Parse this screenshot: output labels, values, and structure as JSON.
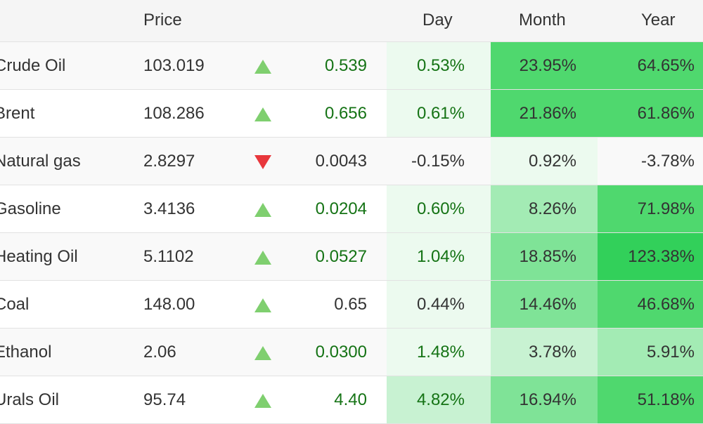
{
  "header": {
    "price": "Price",
    "day": "Day",
    "month": "Month",
    "year": "Year"
  },
  "colors": {
    "up_text": "#157315",
    "down_text": "#a00000",
    "up_arrow": "#7fcf6f",
    "down_arrow": "#e8373c",
    "heat_1": "#ecfaef",
    "heat_2": "#c8f2d2",
    "heat_3": "#a3ebb4",
    "heat_4": "#7fe397",
    "heat_5": "#4fd86e",
    "heat_6": "#32d05a"
  },
  "rows": [
    {
      "name": "Crude Oil",
      "price": "103.019",
      "direction": "up",
      "arrow_icon": "triangle-up-icon",
      "change": "0.539",
      "day": "0.53%",
      "month": "23.95%",
      "year": "64.65%"
    },
    {
      "name": "Brent",
      "price": "108.286",
      "direction": "up",
      "arrow_icon": "triangle-up-icon",
      "change": "0.656",
      "day": "0.61%",
      "month": "21.86%",
      "year": "61.86%"
    },
    {
      "name": "Natural gas",
      "price": "2.8297",
      "direction": "down",
      "arrow_icon": "triangle-down-icon",
      "change": "0.0043",
      "day": "-0.15%",
      "month": "0.92%",
      "year": "-3.78%"
    },
    {
      "name": "Gasoline",
      "price": "3.4136",
      "direction": "up",
      "arrow_icon": "triangle-up-icon",
      "change": "0.0204",
      "day": "0.60%",
      "month": "8.26%",
      "year": "71.98%"
    },
    {
      "name": "Heating Oil",
      "price": "5.1102",
      "direction": "up",
      "arrow_icon": "triangle-up-icon",
      "change": "0.0527",
      "day": "1.04%",
      "month": "18.85%",
      "year": "123.38%"
    },
    {
      "name": "Coal",
      "price": "148.00",
      "direction": "up",
      "arrow_icon": "triangle-up-icon",
      "change": "0.65",
      "day": "0.44%",
      "month": "14.46%",
      "year": "46.68%"
    },
    {
      "name": "Ethanol",
      "price": "2.06",
      "direction": "up",
      "arrow_icon": "triangle-up-icon",
      "change": "0.0300",
      "day": "1.48%",
      "month": "3.78%",
      "year": "5.91%"
    },
    {
      "name": "Urals Oil",
      "price": "95.74",
      "direction": "up",
      "arrow_icon": "triangle-up-icon",
      "change": "4.40",
      "day": "4.82%",
      "month": "16.94%",
      "year": "51.18%"
    }
  ]
}
